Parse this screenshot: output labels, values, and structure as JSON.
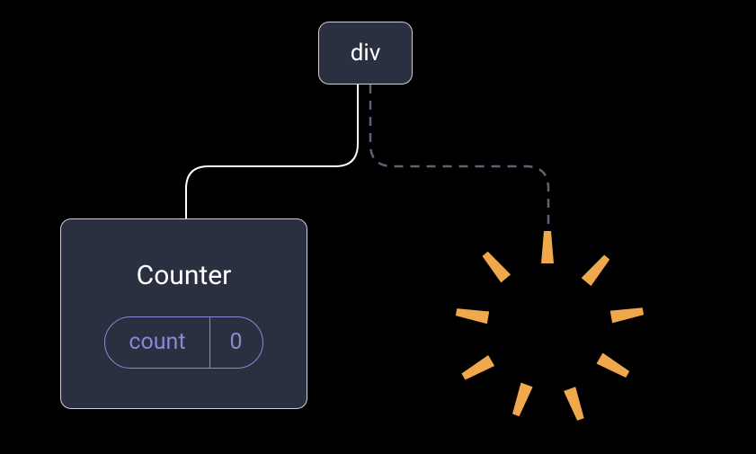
{
  "root": {
    "label": "div"
  },
  "counter": {
    "title": "Counter",
    "state": {
      "key": "count",
      "value": "0"
    }
  },
  "colors": {
    "background": "#000000",
    "nodeBg": "#2a3040",
    "nodeBorder": "#d0d0d0",
    "text": "#ffffff",
    "accent": "#8b89d6",
    "burst": "#f0a84c"
  }
}
